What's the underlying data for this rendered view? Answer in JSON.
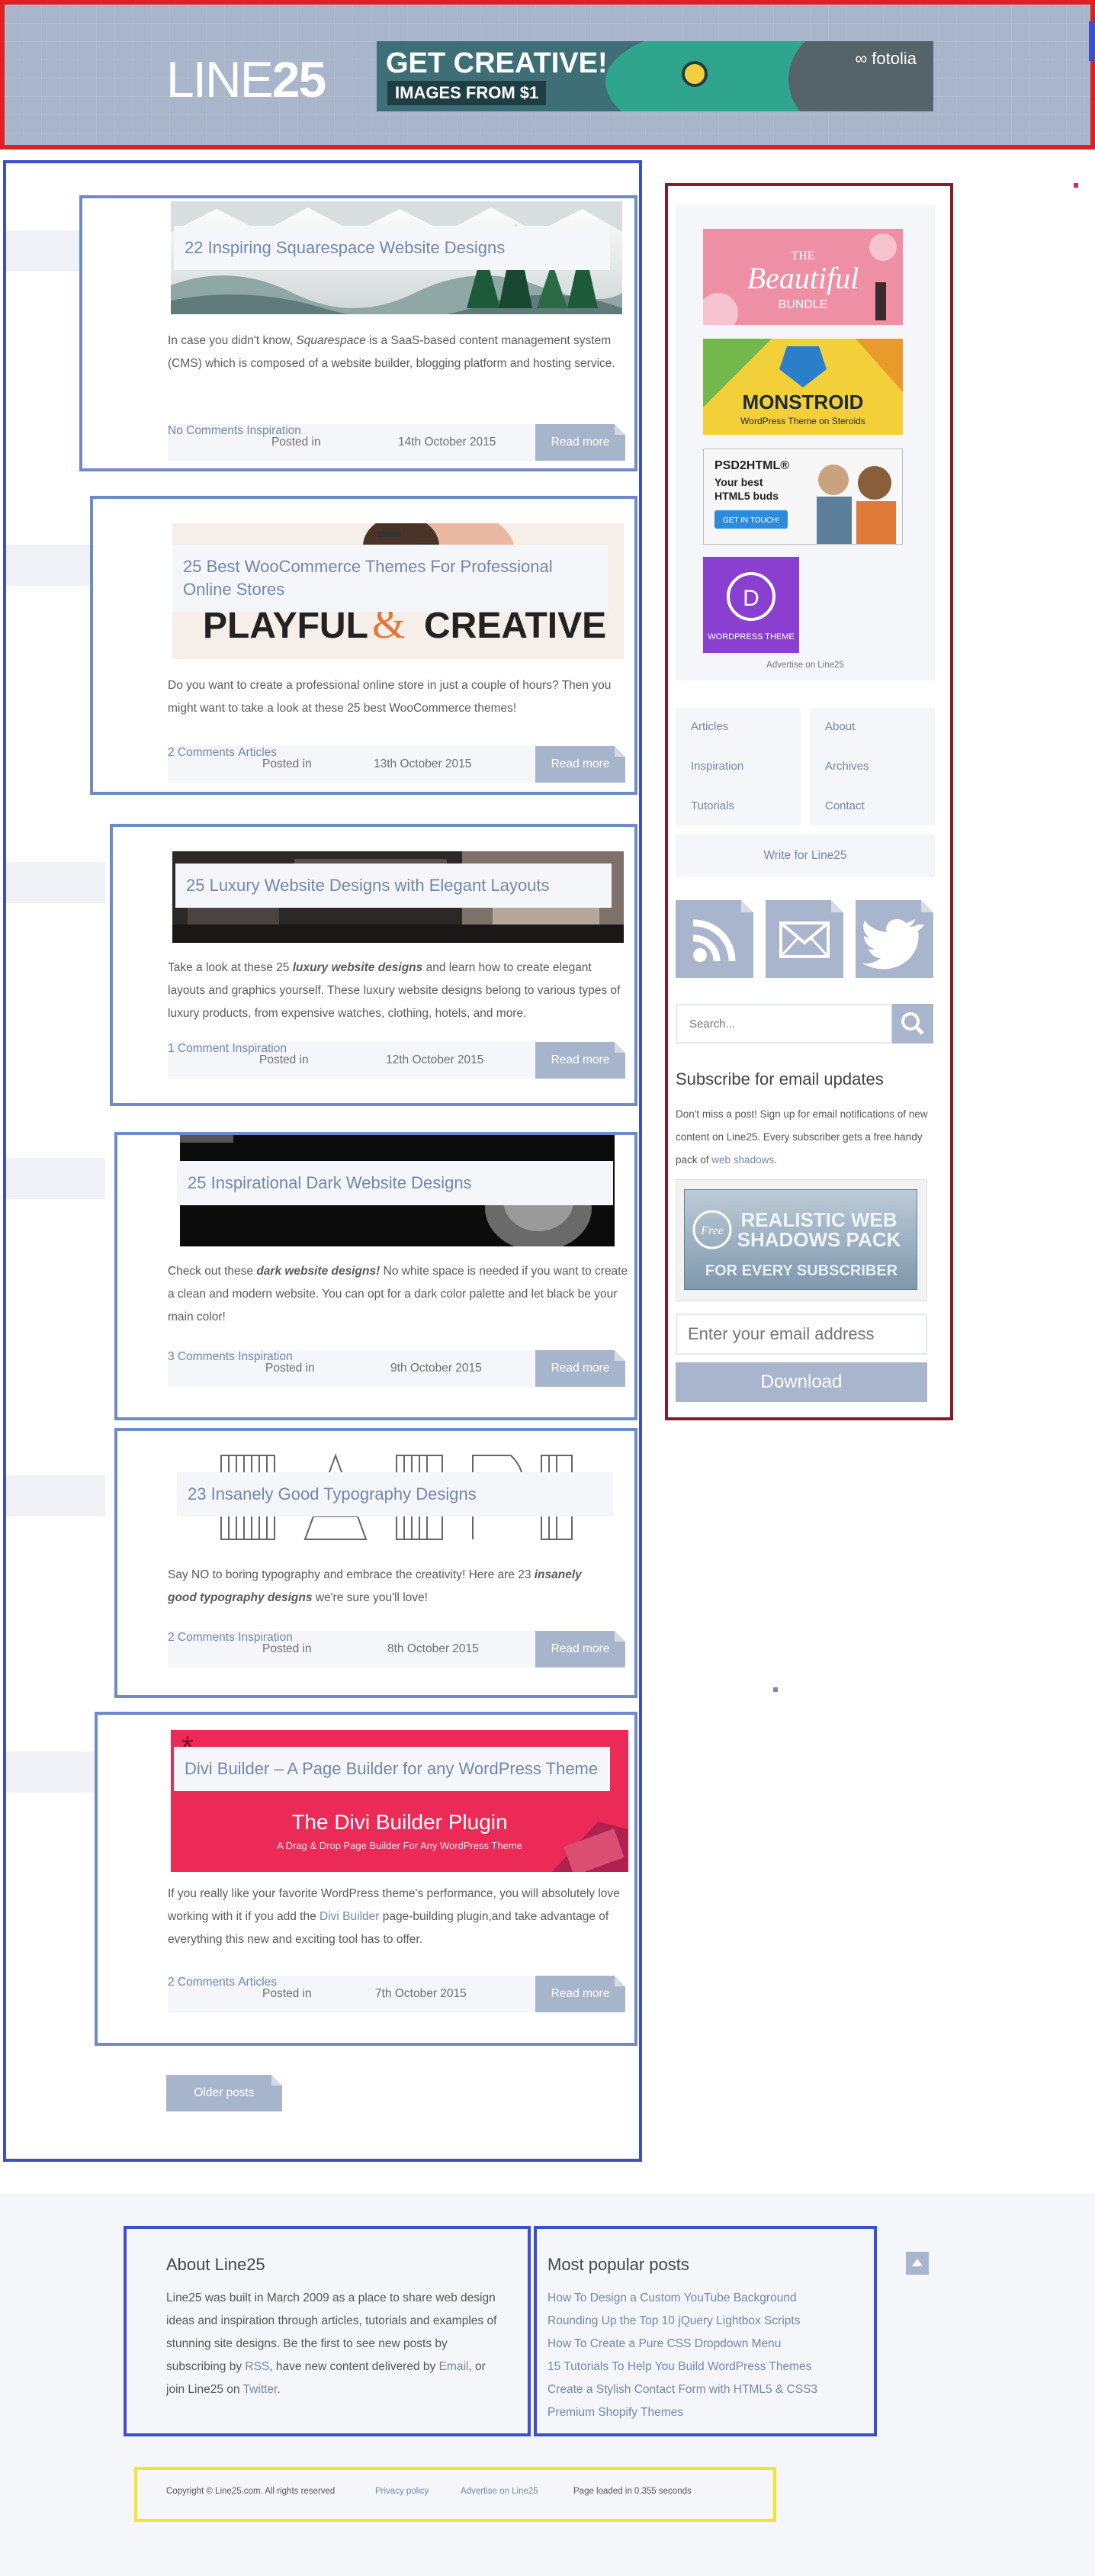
{
  "header": {
    "logo_light": "LINE",
    "logo_bold": "25",
    "banner": {
      "headline": "GET CREATIVE!",
      "subline": "IMAGES FROM $1",
      "brand": "fotolia"
    }
  },
  "posts": [
    {
      "title": "22 Inspiring Squarespace Website Designs",
      "excerpt_parts": [
        "In case you didn't know, ",
        "Squarespace",
        " is a SaaS-based content management system (CMS) which is composed of a website builder, blogging platform and hosting service."
      ],
      "comments": "No Comments",
      "posted_in": "Posted in",
      "category": "Inspiration",
      "date": "14th October 2015",
      "read_more": "Read more"
    },
    {
      "title": "25 Best WooCommerce Themes For Professional Online Stores",
      "excerpt": "Do you want to create a professional online store in just a couple of hours? Then you might want to take a look at these 25 best WooCommerce themes!",
      "comments": "2 Comments",
      "posted_in": "Posted in",
      "category": "Articles",
      "date": "13th October 2015",
      "read_more": "Read more",
      "thumb_text_left": "PLAYFUL",
      "thumb_text_amp": "&",
      "thumb_text_right": "CREATIVE"
    },
    {
      "title": "25 Luxury Website Designs with Elegant Layouts",
      "excerpt_parts": [
        "Take a look at these 25 ",
        "luxury website designs",
        " and learn how to create elegant layouts and graphics yourself. These luxury website designs belong to various types of luxury products, from expensive watches, clothing, hotels, and more."
      ],
      "comments": "1 Comment",
      "posted_in": "Posted in",
      "category": "Inspiration",
      "date": "12th October 2015",
      "read_more": "Read more"
    },
    {
      "title": "25 Inspirational Dark Website Designs",
      "excerpt_parts": [
        "Check out these ",
        "dark website designs!",
        " No white space is needed if you want to create a clean and modern website. You can opt for a dark color palette and let black be your main color!"
      ],
      "comments": "3 Comments",
      "posted_in": "Posted in",
      "category": "Inspiration",
      "date": "9th October 2015",
      "read_more": "Read more"
    },
    {
      "title": "23 Insanely Good Typography Designs",
      "excerpt_parts": [
        "Say NO to boring typography and embrace the creativity! Here are 23 ",
        "insanely good typography designs",
        " we're sure you'll love!"
      ],
      "comments": "2 Comments",
      "posted_in": "Posted in",
      "category": "Inspiration",
      "date": "8th October 2015",
      "read_more": "Read more"
    },
    {
      "title": "Divi Builder – A Page Builder for any WordPress Theme",
      "excerpt_parts": [
        "If you really like your favorite WordPress theme's performance, you will absolutely love working with it if you add the ",
        "Divi Builder",
        " page-building plugin,and take advantage of everything this new and exciting tool has to offer."
      ],
      "comments": "2 Comments",
      "posted_in": "Posted in",
      "category": "Articles",
      "date": "7th October 2015",
      "read_more": "Read more",
      "thumb_heading": "The Divi Builder Plugin",
      "thumb_sub": "A Drag & Drop Page Builder For Any WordPress Theme"
    }
  ],
  "older_posts": "Older posts",
  "sidebar": {
    "ads": {
      "beautiful_small": "THE",
      "beautiful_big": "Beautiful",
      "beautiful_bundle": "BUNDLE",
      "monstroid_title": "MONSTROID",
      "monstroid_sub": "WordPress Theme on Steroids",
      "psd_title": "PSD2HTML®",
      "psd_line1": "Your best",
      "psd_line2": "HTML5 buds",
      "psd_button": "GET IN TOUCH!",
      "divi_label": "WORDPRESS THEME",
      "advertise": "Advertise on Line25"
    },
    "menu_left": [
      "Articles",
      "Inspiration",
      "Tutorials"
    ],
    "menu_right": [
      "About",
      "Archives",
      "Contact"
    ],
    "write_for": "Write for Line25",
    "search_placeholder": "Search...",
    "subscribe_title": "Subscribe for email updates",
    "subscribe_text": "Don't miss a post! Sign up for email notifications of new content on Line25. Every subscriber gets a free handy pack of ",
    "subscribe_link": "web shadows",
    "subscribe_end": ".",
    "shadows_free": "Free",
    "shadows_l1": "REALISTIC WEB",
    "shadows_l2": "SHADOWS PACK",
    "shadows_l3": "FOR EVERY SUBSCRIBER",
    "email_placeholder": "Enter your email address",
    "download": "Download"
  },
  "footer": {
    "about_title": "About Line25",
    "about_text_1": "Line25 was built in March 2009 as a place to share web design ideas and inspiration through articles, tutorials and examples of stunning site designs. Be the first to see new posts by subscribing by ",
    "about_rss": "RSS",
    "about_text_2": ", have new content delivered by ",
    "about_email": "Email",
    "about_text_3": ", or join Line25 on ",
    "about_twitter": "Twitter",
    "about_text_4": ".",
    "popular_title": "Most popular posts",
    "popular": [
      "How To Design a Custom YouTube Background",
      "Rounding Up the Top 10 jQuery Lightbox Scripts",
      "How To Create a Pure CSS Dropdown Menu",
      "15 Tutorials To Help You Build WordPress Themes",
      "Create a Stylish Contact Form with HTML5 & CSS3",
      "Premium Shopify Themes"
    ],
    "copyright": "Copyright © Line25.com. All rights reserved",
    "privacy": "Privacy policy",
    "advertise": "Advertise on Line25",
    "loaded": "Page loaded in 0.355 seconds"
  },
  "colors": {
    "accent": "#a8b5cc",
    "link": "#7387a8",
    "header_bg": "#a8b5cb"
  }
}
